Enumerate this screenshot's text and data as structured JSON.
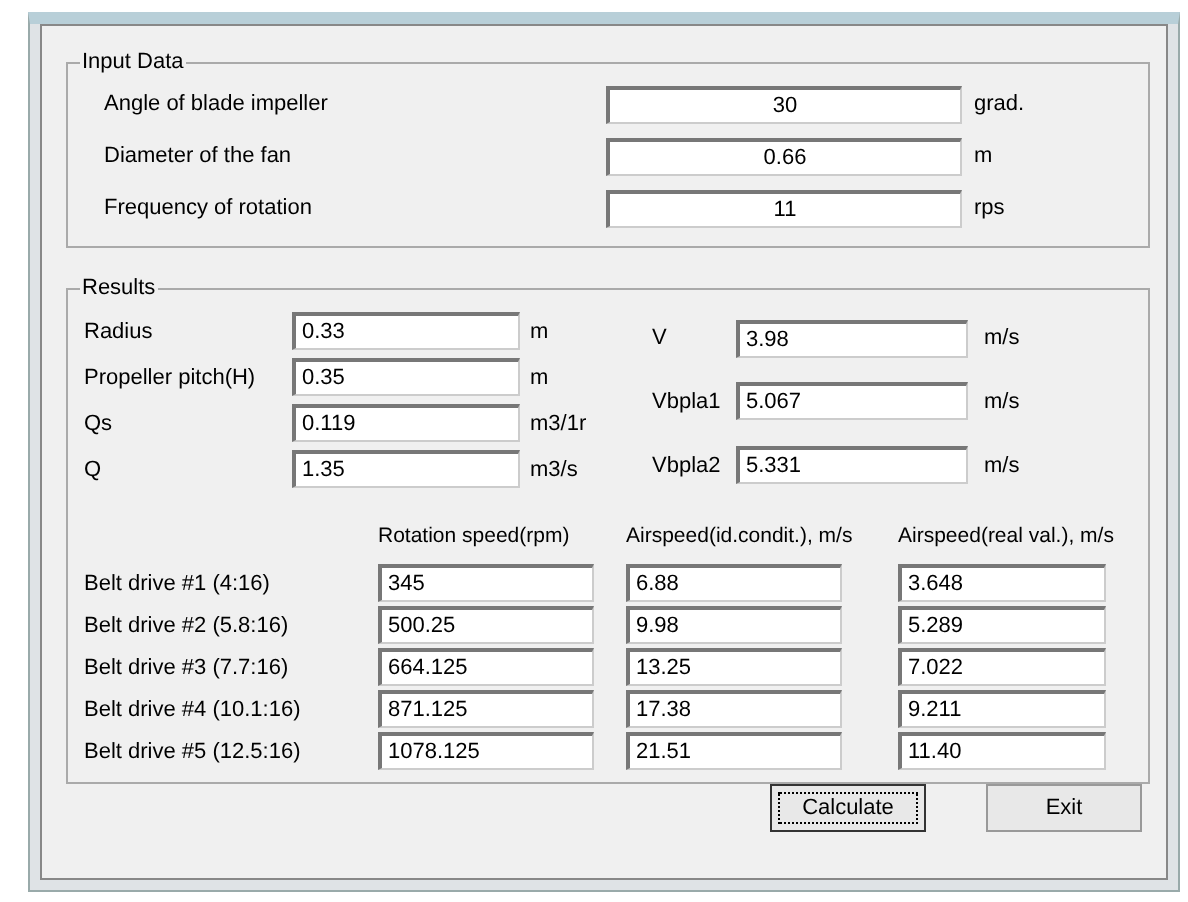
{
  "input_data": {
    "title": "Input Data",
    "rows": [
      {
        "label": "Angle of blade impeller",
        "value": "30",
        "unit": "grad."
      },
      {
        "label": "Diameter of the fan",
        "value": "0.66",
        "unit": "m"
      },
      {
        "label": "Frequency of rotation",
        "value": "11",
        "unit": "rps"
      }
    ]
  },
  "results": {
    "title": "Results",
    "left": [
      {
        "label": "Radius",
        "value": "0.33",
        "unit": "m"
      },
      {
        "label": "Propeller pitch(H)",
        "value": "0.35",
        "unit": "m"
      },
      {
        "label": "Qs",
        "value": "0.119",
        "unit": "m3/1r"
      },
      {
        "label": "Q",
        "value": "1.35",
        "unit": "m3/s"
      }
    ],
    "right": [
      {
        "label": "V",
        "value": "3.98",
        "unit": "m/s"
      },
      {
        "label": "Vbpla1",
        "value": "5.067",
        "unit": "m/s"
      },
      {
        "label": "Vbpla2",
        "value": "5.331",
        "unit": "m/s"
      }
    ],
    "table": {
      "columns": [
        "Rotation speed(rpm)",
        "Airspeed(id.condit.), m/s",
        "Airspeed(real val.), m/s"
      ],
      "rows": [
        {
          "label": "Belt drive #1 (4:16)",
          "cells": [
            "345",
            "6.88",
            "3.648"
          ]
        },
        {
          "label": "Belt drive #2 (5.8:16)",
          "cells": [
            "500.25",
            "9.98",
            "5.289"
          ]
        },
        {
          "label": "Belt drive #3 (7.7:16)",
          "cells": [
            "664.125",
            "13.25",
            "7.022"
          ]
        },
        {
          "label": "Belt drive #4 (10.1:16)",
          "cells": [
            "871.125",
            "17.38",
            "9.211"
          ]
        },
        {
          "label": "Belt drive #5 (12.5:16)",
          "cells": [
            "1078.125",
            "21.51",
            "11.40"
          ]
        }
      ]
    }
  },
  "buttons": [
    {
      "label": "Calculate",
      "focused": true
    },
    {
      "label": "Exit",
      "focused": false
    }
  ]
}
